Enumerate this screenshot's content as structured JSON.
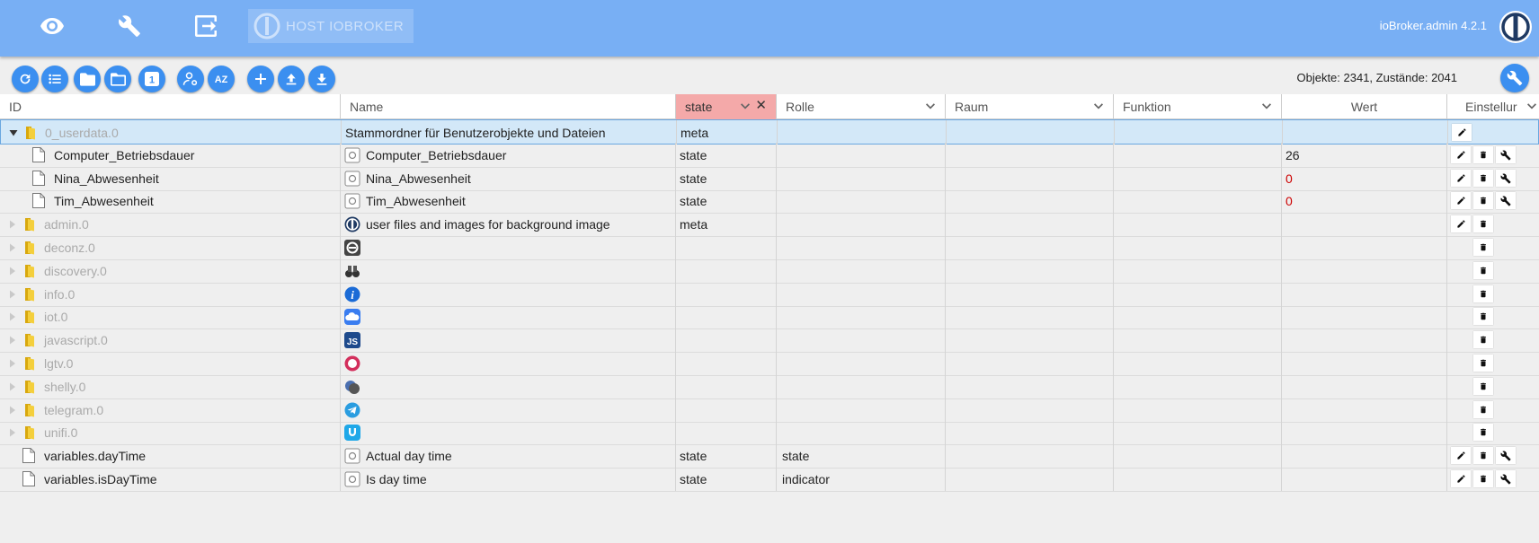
{
  "appbar": {
    "host_label": "HOST IOBROKER",
    "version": "ioBroker.admin 4.2.1",
    "icons": [
      "eye-icon",
      "wrench-icon",
      "logout-icon"
    ]
  },
  "toolbar": {
    "buttons": [
      "refresh-icon",
      "list-icon",
      "folder-icon",
      "folder-outline-icon",
      "one-icon",
      "user-settings-icon",
      "sort-az-icon",
      "add-icon",
      "upload-icon",
      "download-icon"
    ],
    "az_label": "AZ",
    "one_label": "1",
    "counts": "Objekte: 2341, Zustände: 2041"
  },
  "table": {
    "headers": {
      "id": "ID",
      "name": "Name",
      "type": "state",
      "role": "Rolle",
      "room": "Raum",
      "func": "Funktion",
      "value": "Wert",
      "settings": "Einstellur"
    },
    "rows": [
      {
        "id": "0_userdata.0",
        "name": "Stammordner für Benutzerobjekte und Dateien",
        "type": "meta",
        "role": "",
        "value": "",
        "kind": "folder-open",
        "actions": [
          "edit"
        ]
      },
      {
        "id": "Computer_Betriebsdauer",
        "name": "Computer_Betriebsdauer",
        "type": "state",
        "role": "",
        "value": "26",
        "kind": "child",
        "actions": [
          "edit",
          "delete",
          "config"
        ]
      },
      {
        "id": "Nina_Abwesenheit",
        "name": "Nina_Abwesenheit",
        "type": "state",
        "role": "",
        "value": "0",
        "kind": "child",
        "actions": [
          "edit",
          "delete",
          "config"
        ]
      },
      {
        "id": "Tim_Abwesenheit",
        "name": "Tim_Abwesenheit",
        "type": "state",
        "role": "",
        "value": "0",
        "kind": "child",
        "actions": [
          "edit",
          "delete",
          "config"
        ]
      },
      {
        "id": "admin.0",
        "name": "user files and images for background image",
        "type": "meta",
        "role": "",
        "value": "",
        "kind": "folder",
        "actions": [
          "edit",
          "delete"
        ]
      },
      {
        "id": "deconz.0",
        "name": "",
        "type": "",
        "role": "",
        "value": "",
        "kind": "folder",
        "actions": [
          "delete"
        ]
      },
      {
        "id": "discovery.0",
        "name": "",
        "type": "",
        "role": "",
        "value": "",
        "kind": "folder",
        "actions": [
          "delete"
        ]
      },
      {
        "id": "info.0",
        "name": "",
        "type": "",
        "role": "",
        "value": "",
        "kind": "folder",
        "actions": [
          "delete"
        ]
      },
      {
        "id": "iot.0",
        "name": "",
        "type": "",
        "role": "",
        "value": "",
        "kind": "folder",
        "actions": [
          "delete"
        ]
      },
      {
        "id": "javascript.0",
        "name": "",
        "type": "",
        "role": "",
        "value": "",
        "kind": "folder",
        "actions": [
          "delete"
        ]
      },
      {
        "id": "lgtv.0",
        "name": "",
        "type": "",
        "role": "",
        "value": "",
        "kind": "folder",
        "actions": [
          "delete"
        ]
      },
      {
        "id": "shelly.0",
        "name": "",
        "type": "",
        "role": "",
        "value": "",
        "kind": "folder",
        "actions": [
          "delete"
        ]
      },
      {
        "id": "telegram.0",
        "name": "",
        "type": "",
        "role": "",
        "value": "",
        "kind": "folder",
        "actions": [
          "delete"
        ]
      },
      {
        "id": "unifi.0",
        "name": "",
        "type": "",
        "role": "",
        "value": "",
        "kind": "folder",
        "actions": [
          "delete"
        ]
      },
      {
        "id": "variables.dayTime",
        "name": "Actual day time",
        "type": "state",
        "role": "state",
        "value": "",
        "kind": "file",
        "actions": [
          "edit",
          "delete",
          "config"
        ]
      },
      {
        "id": "variables.isDayTime",
        "name": "Is day time",
        "type": "state",
        "role": "indicator",
        "value": "",
        "kind": "file",
        "actions": [
          "edit",
          "delete",
          "config"
        ]
      }
    ],
    "row_icons": [
      "state-icon",
      "state-icon",
      "state-icon",
      "iobroker-admin-icon",
      "deconz-icon",
      "discovery-icon",
      "info-icon",
      "iot-cloud-icon",
      "javascript-icon",
      "lgtv-icon",
      "shelly-icon",
      "telegram-icon",
      "unifi-icon",
      "state-icon",
      "state-icon"
    ]
  },
  "colors": {
    "appbar": "#78aff4",
    "button": "#3b8ff0",
    "state_filter_header": "#f4a9a9",
    "selected_row": "#d3e8f8",
    "value_red": "#cc0000"
  }
}
